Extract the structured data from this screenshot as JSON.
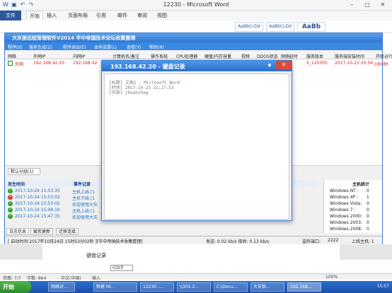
{
  "word": {
    "title": "12230 - Microsoft Word",
    "tabs": [
      "文件",
      "开始",
      "插入",
      "页面布局",
      "引用",
      "邮件",
      "审阅",
      "视图"
    ],
    "styles": [
      "AaBbCcDd",
      "AaBbCcDd",
      "AaBb"
    ],
    "doc_text": "键盘记录",
    "ctrl_tag": "(Ctrl)",
    "status": {
      "page": "页面: 7/7",
      "words": "字数: 864",
      "lang": "中文(中国)",
      "insert": "插入",
      "zoom": "100%"
    }
  },
  "app": {
    "title": "大灰狼远程管理软件V2014   华中帝国技术论坛收集整理",
    "menu": [
      "程序(X)",
      "服务生成(Z)",
      "程序退出(E)",
      "本地设置(L)",
      "查看(Y)",
      "帮助(R)"
    ],
    "columns": [
      "网络",
      "外网IP",
      "内网IP",
      "计算机名/备注",
      "操作系统",
      "CPU处理器",
      "硬盘/内存容量",
      "视频",
      "DDOS状态",
      "网络延时",
      "服务版本",
      "服务端安装时间",
      "开机运行"
    ],
    "row": {
      "net": "外网",
      "ext_ip": "192.168.42.20",
      "int_ip": "192.168.42",
      "version": "S_120305",
      "install_time": "2017-10-23 20:56",
      "uptime": "0天0时"
    },
    "group_tab": "默认分组(1)",
    "log": {
      "head_time": "发生时间",
      "head_event": "事件记录",
      "rows": [
        {
          "time": "2017-10-24 15:53:35",
          "event": "主机上线 [1",
          "status": "ok"
        },
        {
          "time": "2017-10-24 15:53:02",
          "event": "主机下线 [1",
          "status": "off"
        },
        {
          "time": "2017-10-24 15:53:02",
          "event": "欢迎使用大灰",
          "status": "ok"
        },
        {
          "time": "2017-10-24 15:48:19",
          "event": "主机上线 [1",
          "status": "ok"
        },
        {
          "time": "2017-10-24 15:47:35",
          "event": "欢迎使用大灰",
          "status": "ok"
        }
      ]
    },
    "stats": {
      "head": "主机统计",
      "rows": [
        {
          "name": "Windows NT :",
          "value": "0"
        },
        {
          "name": "Windows XP :",
          "value": "1"
        },
        {
          "name": "Windows Vista:",
          "value": "0"
        },
        {
          "name": "Windows 7 :",
          "value": "0"
        },
        {
          "name": "Windows 2000:",
          "value": "0"
        },
        {
          "name": "Windows 2003:",
          "value": "0"
        },
        {
          "name": "Windows 2008:",
          "value": "0"
        }
      ]
    },
    "bottom_tabs": [
      "日志信息",
      "赋名更新",
      "迁移连接"
    ],
    "status_bar": {
      "start": "[ 启动时间:2017年10月24日 15时53分02秒 ][华中帝国技术收集整理]",
      "traffic": "发送: 0.02 kb/s 接收: 0.13 kb/s",
      "port_label": "监听端口:",
      "port": "2222",
      "online": "上线主机: 1"
    }
  },
  "popup": {
    "title": "192.168.42.20 - 键盘记录",
    "lines": [
      "[标题] 文档1 - Microsoft Word",
      "[时间] 2017-10-23  21:27:53",
      "[内容] jhuahzhag"
    ]
  },
  "taskbar": {
    "start": "开始",
    "tasks": [
      "网络对...",
      "新建 Mi...",
      "12230 -...",
      "\\\\301-2...",
      "C:\\Docu...",
      "大灰狼...",
      "192.168..."
    ],
    "clock": "15:57"
  },
  "colors": {
    "title_blue": "#2f76d1",
    "link_red": "#d0211c",
    "log_blue": "#1a6fc0",
    "close_red": "#d94a3a"
  }
}
